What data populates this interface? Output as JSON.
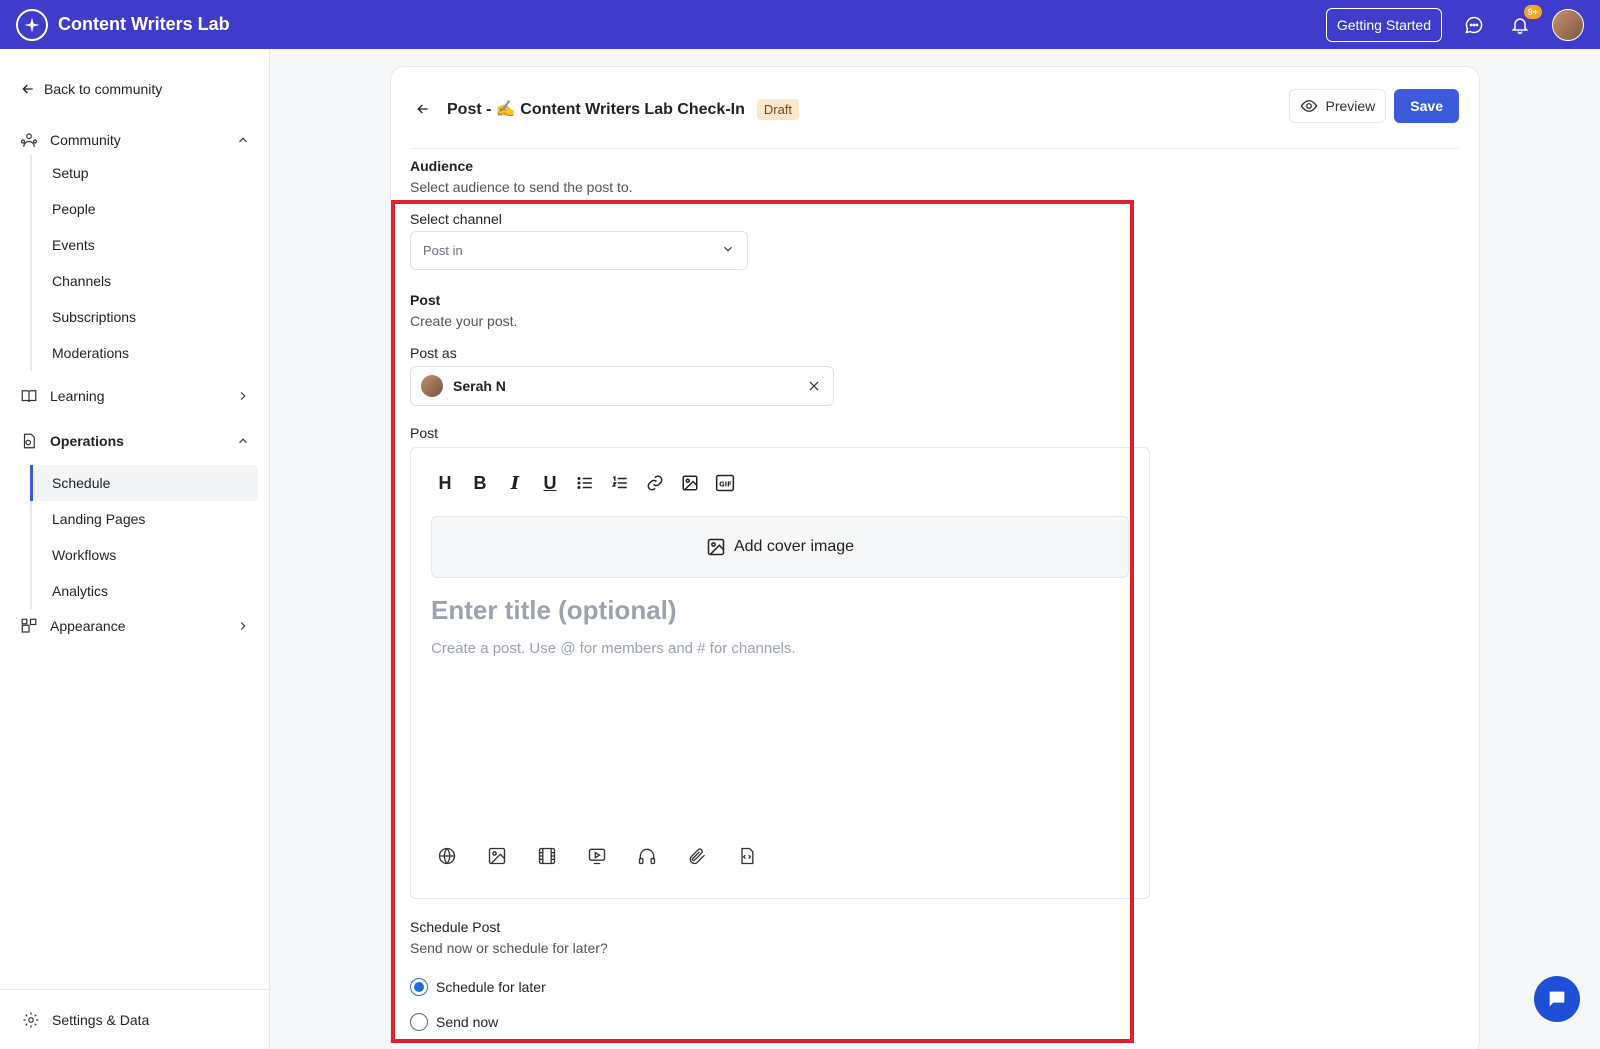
{
  "app": {
    "name": "Content Writers Lab"
  },
  "topbar": {
    "getting_started": "Getting Started",
    "notifications_badge": "9+"
  },
  "sidebar": {
    "back_label": "Back to community",
    "sections": {
      "community": {
        "label": "Community",
        "items": [
          "Setup",
          "People",
          "Events",
          "Channels",
          "Subscriptions",
          "Moderations"
        ]
      },
      "learning": {
        "label": "Learning"
      },
      "operations": {
        "label": "Operations",
        "items": [
          "Schedule",
          "Landing Pages",
          "Workflows",
          "Analytics"
        ]
      },
      "appearance": {
        "label": "Appearance"
      }
    },
    "settings_label": "Settings & Data"
  },
  "page": {
    "title": "Post - ✍️ Content Writers Lab Check-In",
    "status": "Draft",
    "preview_label": "Preview",
    "save_label": "Save"
  },
  "form": {
    "audience": {
      "heading": "Audience",
      "description": "Select audience to send the post to."
    },
    "channel": {
      "label": "Select channel",
      "placeholder": "Post in"
    },
    "post": {
      "heading": "Post",
      "description": "Create your post."
    },
    "post_as": {
      "label": "Post as",
      "value": "Serah N"
    },
    "editor": {
      "label": "Post",
      "cover_label": "Add cover image",
      "title_placeholder": "Enter title (optional)",
      "body_placeholder": "Create a post. Use @ for members and # for channels."
    },
    "schedule": {
      "heading": "Schedule Post",
      "description": "Send now or schedule for later?",
      "options": [
        {
          "label": "Schedule for later",
          "selected": true
        },
        {
          "label": "Send now",
          "selected": false
        }
      ]
    }
  },
  "colors": {
    "topbar": "#3f3ccb",
    "primary": "#3b5bdb",
    "highlight": "#e0202a"
  }
}
